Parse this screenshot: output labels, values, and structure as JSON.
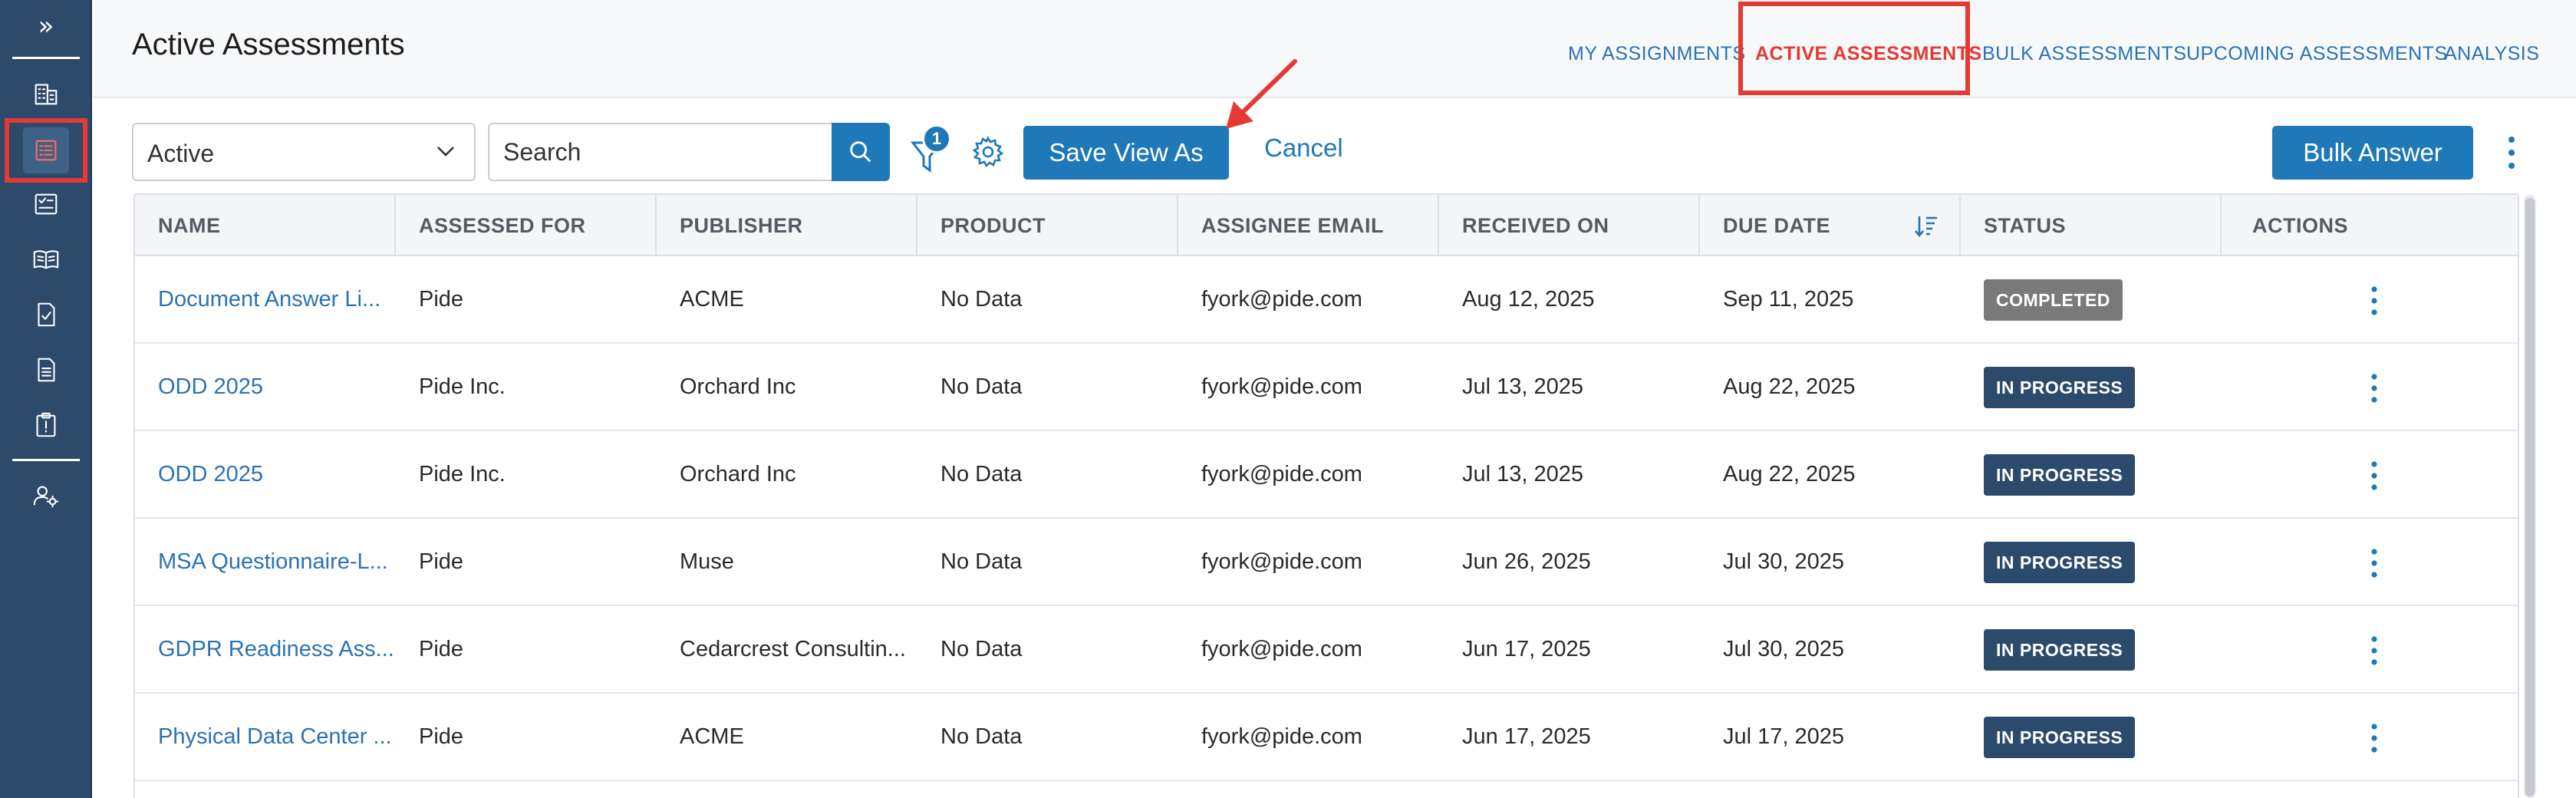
{
  "header": {
    "title": "Active Assessments",
    "nav": [
      {
        "label": "MY ASSIGNMENTS",
        "active": false
      },
      {
        "label": "ACTIVE ASSESSMENTS",
        "active": true
      },
      {
        "label": "BULK ASSESSMENTS",
        "active": false
      },
      {
        "label": "UPCOMING ASSESSMENTS",
        "active": false
      },
      {
        "label": "ANALYSIS",
        "active": false
      }
    ]
  },
  "toolbar": {
    "view_select": "Active",
    "search_placeholder": "Search",
    "filter_count": "1",
    "save_view_label": "Save View As",
    "cancel_label": "Cancel",
    "bulk_answer_label": "Bulk Answer"
  },
  "table": {
    "columns": [
      "NAME",
      "ASSESSED FOR",
      "PUBLISHER",
      "PRODUCT",
      "ASSIGNEE EMAIL",
      "RECEIVED ON",
      "DUE DATE",
      "STATUS",
      "ACTIONS"
    ],
    "rows": [
      {
        "name": "Document Answer Li...",
        "assessed_for": "Pide",
        "publisher": "ACME",
        "product": "No Data",
        "email": "fyork@pide.com",
        "received": "Aug 12, 2025",
        "due": "Sep 11, 2025",
        "status": "COMPLETED"
      },
      {
        "name": "ODD 2025",
        "assessed_for": "Pide Inc.",
        "publisher": "Orchard Inc",
        "product": "No Data",
        "email": "fyork@pide.com",
        "received": "Jul 13, 2025",
        "due": "Aug 22, 2025",
        "status": "IN PROGRESS"
      },
      {
        "name": "ODD 2025",
        "assessed_for": "Pide Inc.",
        "publisher": "Orchard Inc",
        "product": "No Data",
        "email": "fyork@pide.com",
        "received": "Jul 13, 2025",
        "due": "Aug 22, 2025",
        "status": "IN PROGRESS"
      },
      {
        "name": "MSA Questionnaire-L...",
        "assessed_for": "Pide",
        "publisher": "Muse",
        "product": "No Data",
        "email": "fyork@pide.com",
        "received": "Jun 26, 2025",
        "due": "Jul 30, 2025",
        "status": "IN PROGRESS"
      },
      {
        "name": "GDPR Readiness Ass...",
        "assessed_for": "Pide",
        "publisher": "Cedarcrest Consultin...",
        "product": "No Data",
        "email": "fyork@pide.com",
        "received": "Jun 17, 2025",
        "due": "Jul 30, 2025",
        "status": "IN PROGRESS"
      },
      {
        "name": "Physical Data Center ...",
        "assessed_for": "Pide",
        "publisher": "ACME",
        "product": "No Data",
        "email": "fyork@pide.com",
        "received": "Jun 17, 2025",
        "due": "Jul 17, 2025",
        "status": "IN PROGRESS"
      }
    ]
  },
  "colors": {
    "sidebar": "#2e4a6b",
    "accent": "#1f78b7",
    "highlight": "#e53935",
    "status_completed": "#7a7a7a",
    "status_in_progress": "#2c4a6b"
  }
}
